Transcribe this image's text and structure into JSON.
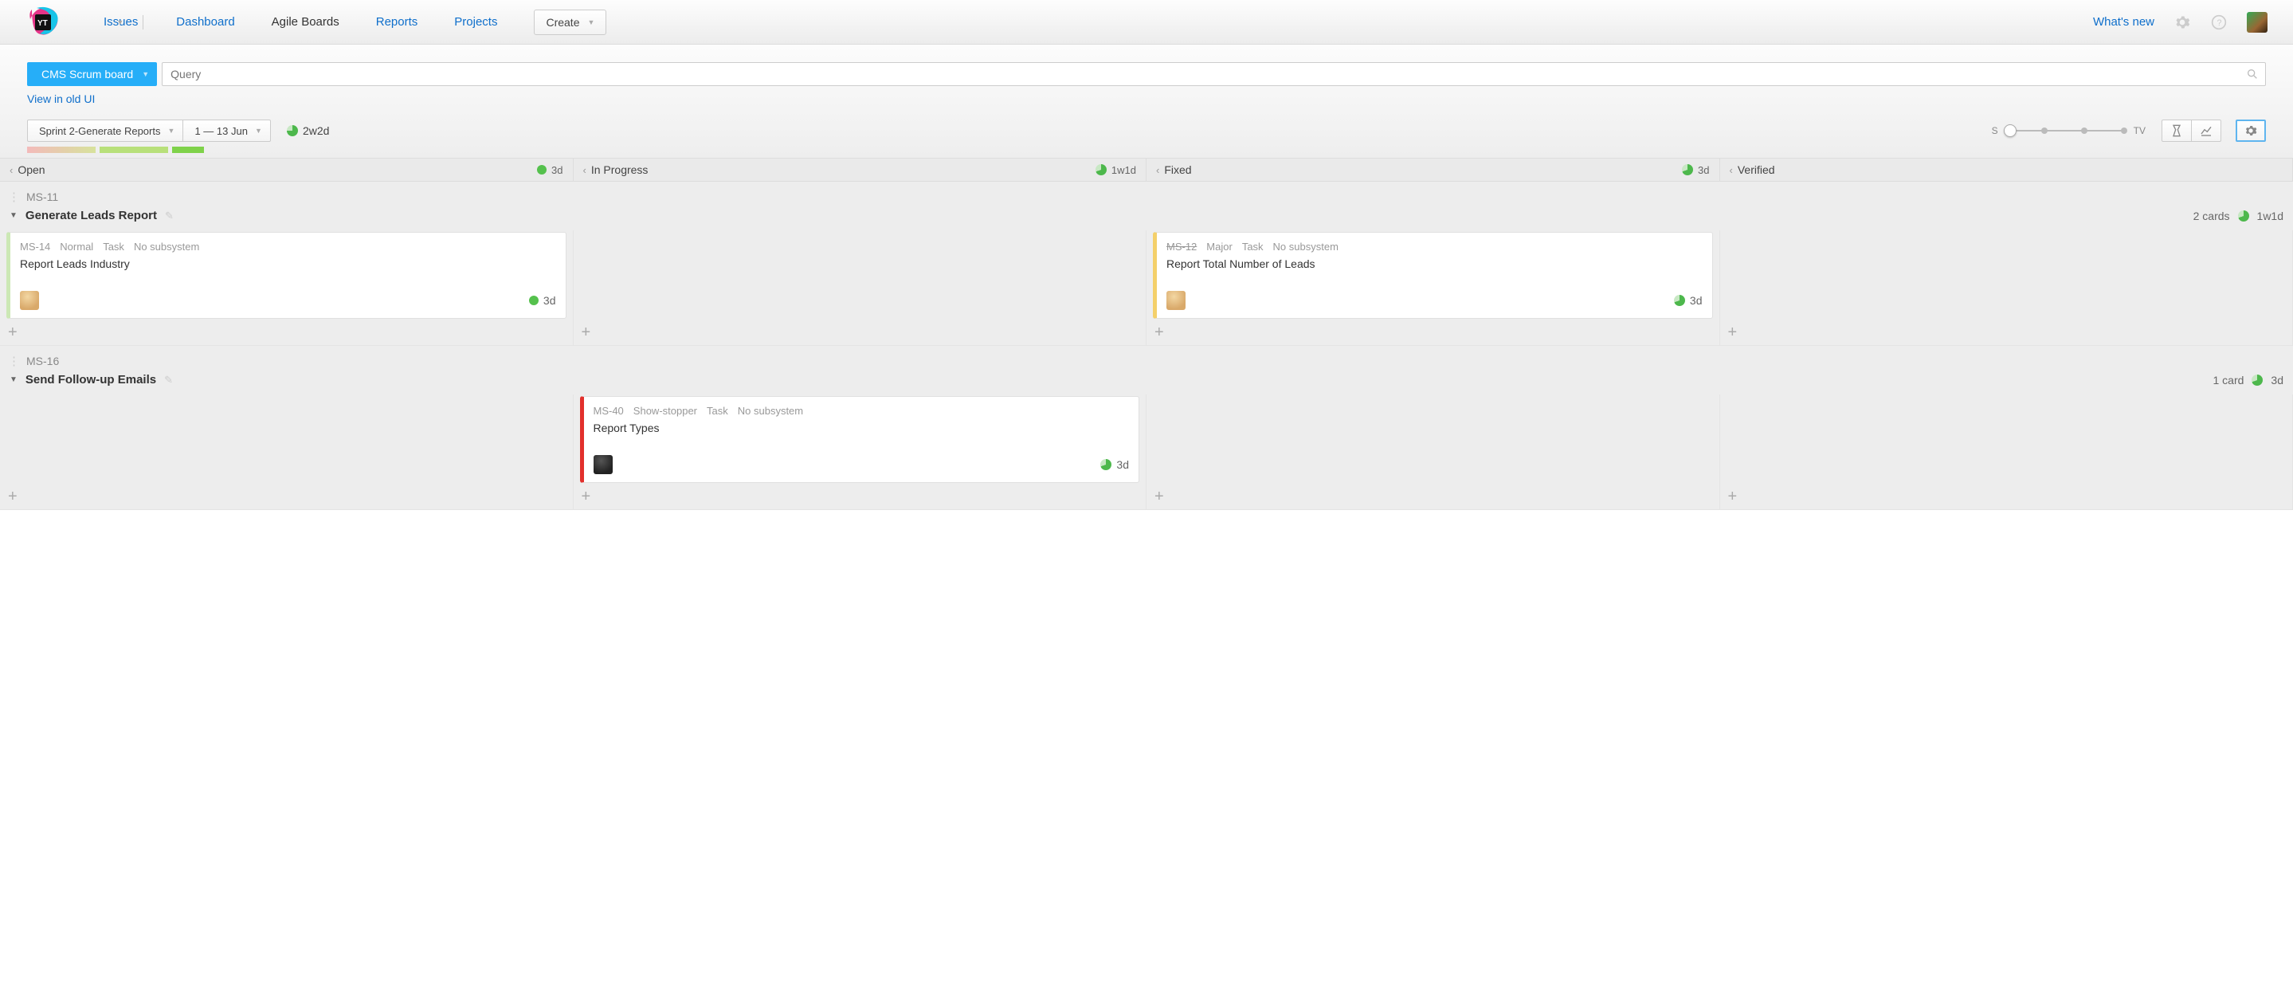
{
  "nav": {
    "issues": "Issues",
    "dashboard": "Dashboard",
    "agile": "Agile Boards",
    "reports": "Reports",
    "projects": "Projects",
    "create": "Create",
    "whatsnew": "What's new"
  },
  "board": {
    "selector": "CMS Scrum board",
    "query_placeholder": "Query",
    "view_old": "View in old UI",
    "sprint": "Sprint 2-Generate Reports",
    "dates": "1 — 13 Jun",
    "duration": "2w2d",
    "slider_left": "S",
    "slider_right": "TV"
  },
  "columns": [
    {
      "name": "Open",
      "time": "3d",
      "pie": "full"
    },
    {
      "name": "In Progress",
      "time": "1w1d",
      "pie": "70"
    },
    {
      "name": "Fixed",
      "time": "3d",
      "pie": "70"
    },
    {
      "name": "Verified",
      "time": "",
      "pie": ""
    }
  ],
  "lanes": [
    {
      "id": "MS-11",
      "title": "Generate Leads Report",
      "count": "2 cards",
      "time": "1w1d",
      "cards": [
        {
          "col": 0,
          "color": "green",
          "id": "MS-14",
          "strike": false,
          "priority": "Normal",
          "type": "Task",
          "subsystem": "No subsystem",
          "title": "Report Leads Industry",
          "time": "3d",
          "pie": "full",
          "avatar": "av1"
        },
        {
          "col": 2,
          "color": "yellow",
          "id": "MS-12",
          "strike": true,
          "priority": "Major",
          "type": "Task",
          "subsystem": "No subsystem",
          "title": "Report Total Number of Leads",
          "time": "3d",
          "pie": "70",
          "avatar": "av1"
        }
      ]
    },
    {
      "id": "MS-16",
      "title": "Send Follow-up Emails",
      "count": "1 card",
      "time": "3d",
      "cards": [
        {
          "col": 1,
          "color": "red",
          "id": "MS-40",
          "strike": false,
          "priority": "Show-stopper",
          "type": "Task",
          "subsystem": "No subsystem",
          "title": "Report Types",
          "time": "3d",
          "pie": "70",
          "avatar": "av2"
        }
      ]
    }
  ]
}
